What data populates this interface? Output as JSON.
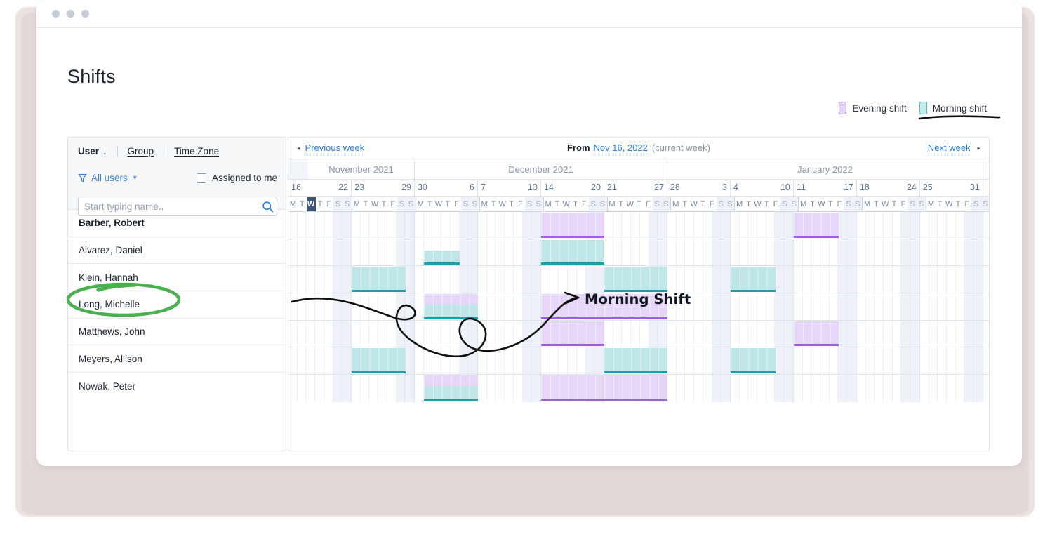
{
  "window": {
    "dots": [
      "close-dot",
      "minimize-dot",
      "maximize-dot"
    ]
  },
  "page": {
    "title": "Shifts"
  },
  "legend": {
    "items": [
      {
        "label": "Evening shift",
        "color": "#e4d4f7",
        "border": "#b58ee0",
        "key": "evening"
      },
      {
        "label": "Morning shift",
        "color": "#c6e9e9",
        "border": "#4fc0c8",
        "key": "morning"
      }
    ]
  },
  "sidebar": {
    "tabs": [
      {
        "label": "User",
        "sort": "↓",
        "active": true
      },
      {
        "label": "Group",
        "active": false
      },
      {
        "label": "Time Zone",
        "active": false
      }
    ],
    "filter": {
      "label": "All users",
      "icon": "funnel-icon",
      "chevron": "⌄"
    },
    "assigned": {
      "label": "Assigned to me",
      "checked": false
    },
    "search": {
      "placeholder": "Start typing name..",
      "value": "",
      "icon": "search-icon"
    },
    "users": [
      {
        "name": "Barber, Robert",
        "bold": true,
        "highlighted": false
      },
      {
        "name": "Alvarez, Daniel",
        "bold": false,
        "highlighted": false
      },
      {
        "name": "Klein, Hannah",
        "bold": false,
        "highlighted": true
      },
      {
        "name": "Long, Michelle",
        "bold": false,
        "highlighted": false
      },
      {
        "name": "Matthews, John",
        "bold": false,
        "highlighted": false
      },
      {
        "name": "Meyers, Allison",
        "bold": false,
        "highlighted": false
      },
      {
        "name": "Nowak, Peter",
        "bold": false,
        "highlighted": false
      }
    ]
  },
  "calendar": {
    "nav": {
      "prev_label": "Previous week",
      "prev_arrow": "◂",
      "from_label": "From",
      "from_date": "Nov 16, 2022",
      "from_note": "(current week)",
      "next_label": "Next week",
      "next_arrow": "▸"
    },
    "months": [
      {
        "label": "November 2021",
        "weeks": 2
      },
      {
        "label": "December 2021",
        "weeks": 4
      },
      {
        "label": "January 2022",
        "weeks": 5
      }
    ],
    "weeks": [
      {
        "start": "16",
        "end": "22"
      },
      {
        "start": "23",
        "end": "29"
      },
      {
        "start": "30",
        "end": "6"
      },
      {
        "start": "7",
        "end": "13"
      },
      {
        "start": "14",
        "end": "20"
      },
      {
        "start": "21",
        "end": "27"
      },
      {
        "start": "28",
        "end": "3"
      },
      {
        "start": "4",
        "end": "10"
      },
      {
        "start": "11",
        "end": "17"
      },
      {
        "start": "18",
        "end": "24"
      },
      {
        "start": "25",
        "end": "31"
      }
    ],
    "day_letters": [
      "M",
      "T",
      "W",
      "T",
      "F",
      "S",
      "S"
    ],
    "today": {
      "week": 0,
      "day": 2,
      "letter": "W"
    },
    "rows": [
      {
        "user": "Barber, Robert",
        "shifts": [
          {
            "type": "evening",
            "week": 4,
            "start_day": 0,
            "days": 7
          },
          {
            "type": "evening",
            "week": 8,
            "start_day": 0,
            "days": 5
          }
        ]
      },
      {
        "user": "Alvarez, Daniel",
        "shifts": [
          {
            "type": "morning",
            "week": 2,
            "start_day": 1,
            "days": 4,
            "half": true
          },
          {
            "type": "morning",
            "week": 4,
            "start_day": 0,
            "days": 7
          }
        ]
      },
      {
        "user": "Klein, Hannah",
        "shifts": [
          {
            "type": "morning",
            "week": 1,
            "start_day": 0,
            "days": 6
          },
          {
            "type": "morning",
            "week": 5,
            "start_day": 0,
            "days": 7
          },
          {
            "type": "morning",
            "week": 7,
            "start_day": 0,
            "days": 5
          }
        ]
      },
      {
        "user": "Long, Michelle",
        "shifts": [
          {
            "type": "evening",
            "week": 2,
            "start_day": 1,
            "days": 6
          },
          {
            "type": "morning",
            "week": 2,
            "start_day": 1,
            "days": 6,
            "half": true
          },
          {
            "type": "evening",
            "week": 4,
            "start_day": 0,
            "days": 7
          },
          {
            "type": "evening",
            "week": 5,
            "start_day": 0,
            "days": 7
          }
        ]
      },
      {
        "user": "Matthews, John",
        "shifts": [
          {
            "type": "evening",
            "week": 4,
            "start_day": 0,
            "days": 7
          },
          {
            "type": "evening",
            "week": 8,
            "start_day": 0,
            "days": 5
          }
        ]
      },
      {
        "user": "Meyers, Allison",
        "shifts": [
          {
            "type": "morning",
            "week": 1,
            "start_day": 0,
            "days": 6
          },
          {
            "type": "morning",
            "week": 5,
            "start_day": 0,
            "days": 7
          },
          {
            "type": "morning",
            "week": 7,
            "start_day": 0,
            "days": 5
          }
        ]
      },
      {
        "user": "Nowak, Peter",
        "shifts": [
          {
            "type": "evening",
            "week": 2,
            "start_day": 1,
            "days": 6
          },
          {
            "type": "morning",
            "week": 2,
            "start_day": 1,
            "days": 6,
            "half": true
          },
          {
            "type": "evening",
            "week": 4,
            "start_day": 0,
            "days": 7
          },
          {
            "type": "evening",
            "week": 5,
            "start_day": 0,
            "days": 7
          }
        ]
      }
    ]
  },
  "annotations": {
    "morning_shift_label": "Morning Shift",
    "highlight_circle_target": "Klein, Hannah",
    "highlight_color": "#4cb050",
    "arrow_color": "#101010"
  }
}
